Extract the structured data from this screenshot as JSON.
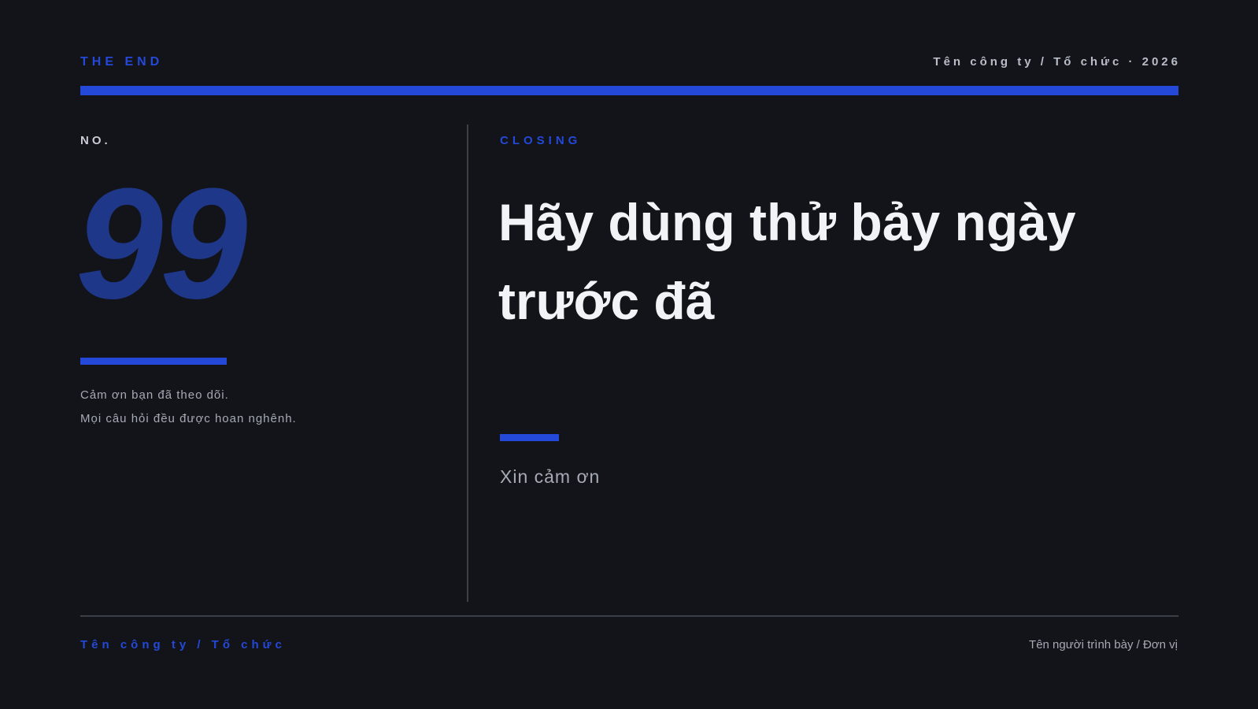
{
  "header": {
    "label": "THE END",
    "org_year": "Tên công ty / Tổ chức · 2026"
  },
  "left": {
    "no_label": "NO.",
    "number": "99",
    "note_line_1": "Cảm ơn bạn đã theo dõi.",
    "note_line_2": "Mọi câu hỏi đều được hoan nghênh."
  },
  "right": {
    "section_label": "CLOSING",
    "headline": "Hãy dùng thử bảy ngày trước đã",
    "thanks": "Xin cảm ơn"
  },
  "footer": {
    "org": "Tên công ty / Tổ chức",
    "presenter": "Tên người trình bày / Đơn vị"
  },
  "colors": {
    "background": "#12141a",
    "accent": "#2449d8",
    "number": "#1e3789",
    "headline": "#f2f3f6",
    "muted": "#a6aab4"
  }
}
